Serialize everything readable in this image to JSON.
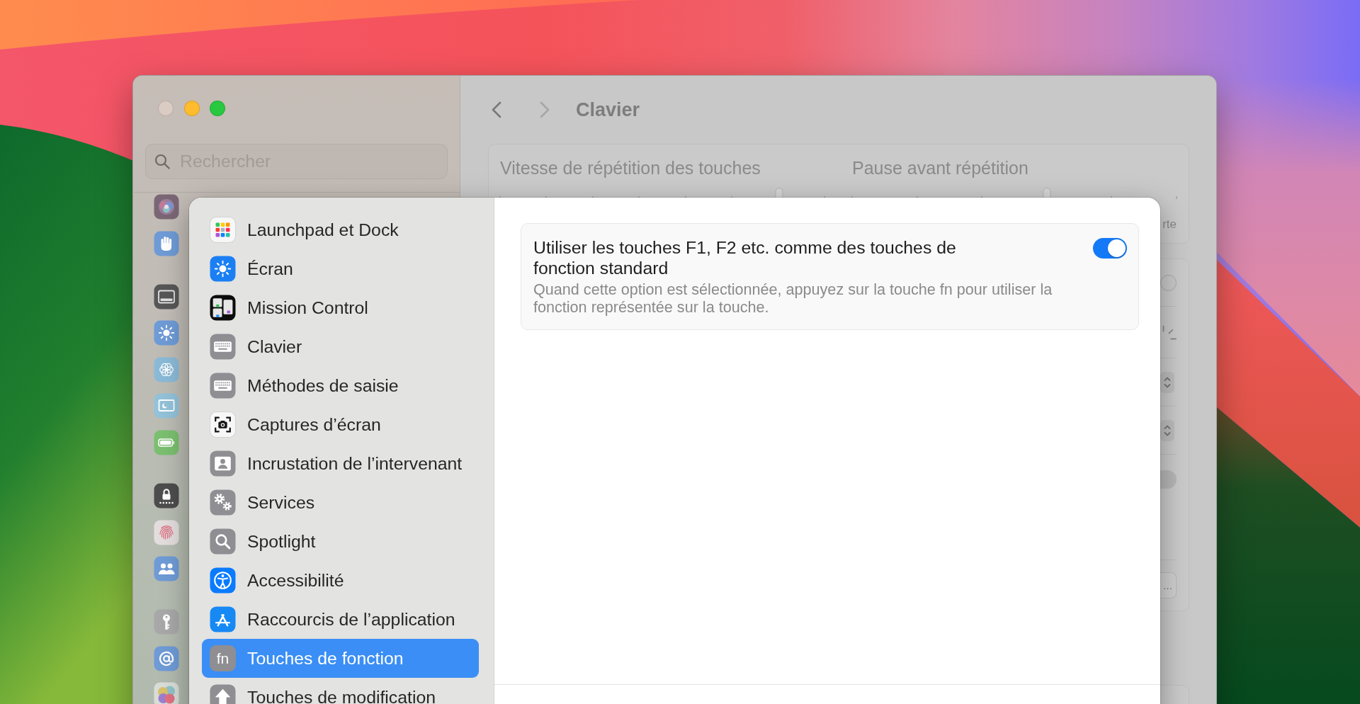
{
  "window": {
    "traffic_lights": [
      {
        "kind": "close",
        "disabled": true
      },
      {
        "kind": "minimize",
        "disabled": false
      },
      {
        "kind": "zoom",
        "disabled": false
      }
    ],
    "search": {
      "placeholder": "Rechercher"
    },
    "sidebar": {
      "groups": [
        {
          "items": [
            {
              "kind": "siri"
            },
            {
              "kind": "hand"
            }
          ]
        },
        {
          "items": [
            {
              "kind": "menubar"
            },
            {
              "kind": "display"
            },
            {
              "kind": "flower"
            },
            {
              "kind": "screensaver"
            },
            {
              "kind": "battery"
            }
          ]
        },
        {
          "items": [
            {
              "kind": "lock"
            },
            {
              "kind": "fingerprint"
            },
            {
              "kind": "users"
            }
          ]
        },
        {
          "items": [
            {
              "kind": "key"
            },
            {
              "kind": "at"
            },
            {
              "kind": "gamecenter"
            }
          ]
        }
      ]
    },
    "navigation": [
      {
        "kind": "back",
        "disabled": false
      },
      {
        "kind": "forward",
        "disabled": true
      }
    ],
    "title": "Clavier",
    "repeat_card": {
      "sliders": [
        {
          "kind": "speed",
          "label": "Vitesse de répétition des touches",
          "level": 0.86
        },
        {
          "kind": "delay",
          "label": "Pause avant répétition",
          "level": 0.6,
          "end_label": "rte"
        }
      ]
    },
    "settings_card": {
      "rows": [
        {
          "kind": "knob"
        },
        {
          "kind": "brightness"
        },
        {
          "kind": "popup"
        },
        {
          "kind": "popup"
        },
        {
          "kind": "toggle",
          "on": false
        },
        {
          "kind": "button",
          "label": "…"
        }
      ]
    }
  },
  "sheet": {
    "sidebar": {
      "items": [
        {
          "label": "Launchpad et Dock",
          "kind": "launchpad",
          "selected": false
        },
        {
          "label": "Écran",
          "kind": "display",
          "selected": false
        },
        {
          "label": "Mission Control",
          "kind": "missioncontrol",
          "selected": false
        },
        {
          "label": "Clavier",
          "kind": "keyboard",
          "selected": false
        },
        {
          "label": "Méthodes de saisie",
          "kind": "keyboard",
          "selected": false
        },
        {
          "label": "Captures d’écran",
          "kind": "screenshot",
          "selected": false
        },
        {
          "label": "Incrustation de l’intervenant",
          "kind": "presenter",
          "selected": false
        },
        {
          "label": "Services",
          "kind": "gears",
          "selected": false
        },
        {
          "label": "Spotlight",
          "kind": "search",
          "selected": false
        },
        {
          "label": "Accessibilité",
          "kind": "accessibility",
          "selected": false
        },
        {
          "label": "Raccourcis de l’application",
          "kind": "appstore",
          "selected": false
        },
        {
          "label": "Touches de fonction",
          "kind": "fn",
          "icon_label": "fn",
          "selected": true
        },
        {
          "label": "Touches de modification",
          "kind": "shift",
          "selected": false
        }
      ]
    },
    "option": {
      "title": "Utiliser les touches F1, F2 etc. comme des touches de fonction standard",
      "description": "Quand cette option est sélectionnée, appuyez sur la touche fn pour utiliser la fonction représentée sur la touche.",
      "on": true
    }
  }
}
